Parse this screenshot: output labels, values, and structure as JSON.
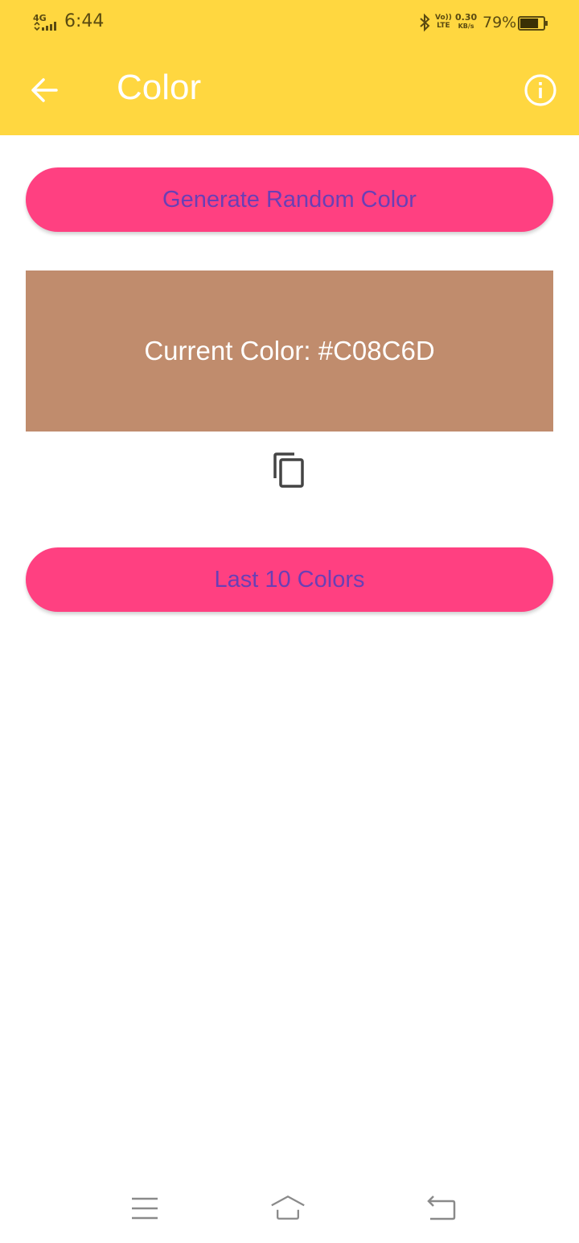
{
  "status_bar": {
    "network": "4G",
    "time": "6:44",
    "volte_top": "Vo))",
    "volte_bottom": "LTE",
    "speed_value": "0.30",
    "speed_unit": "KB/s",
    "battery_percent": "79%",
    "battery_level": 0.79
  },
  "app_bar": {
    "title": "Color",
    "back_icon": "arrow-back-icon",
    "info_icon": "info-icon",
    "background": "#FFD740"
  },
  "main": {
    "generate_button_label": "Generate Random Color",
    "current_color_text": "Current Color: #C08C6D",
    "current_color_hex": "#C08C6D",
    "copy_icon": "copy-icon",
    "last_colors_button_label": "Last 10 Colors",
    "button_color": "#FF4081",
    "button_text_color": "#6A3FB5"
  },
  "nav_bar": {
    "menu_icon": "menu-icon",
    "home_icon": "home-icon",
    "back_icon": "back-icon"
  }
}
